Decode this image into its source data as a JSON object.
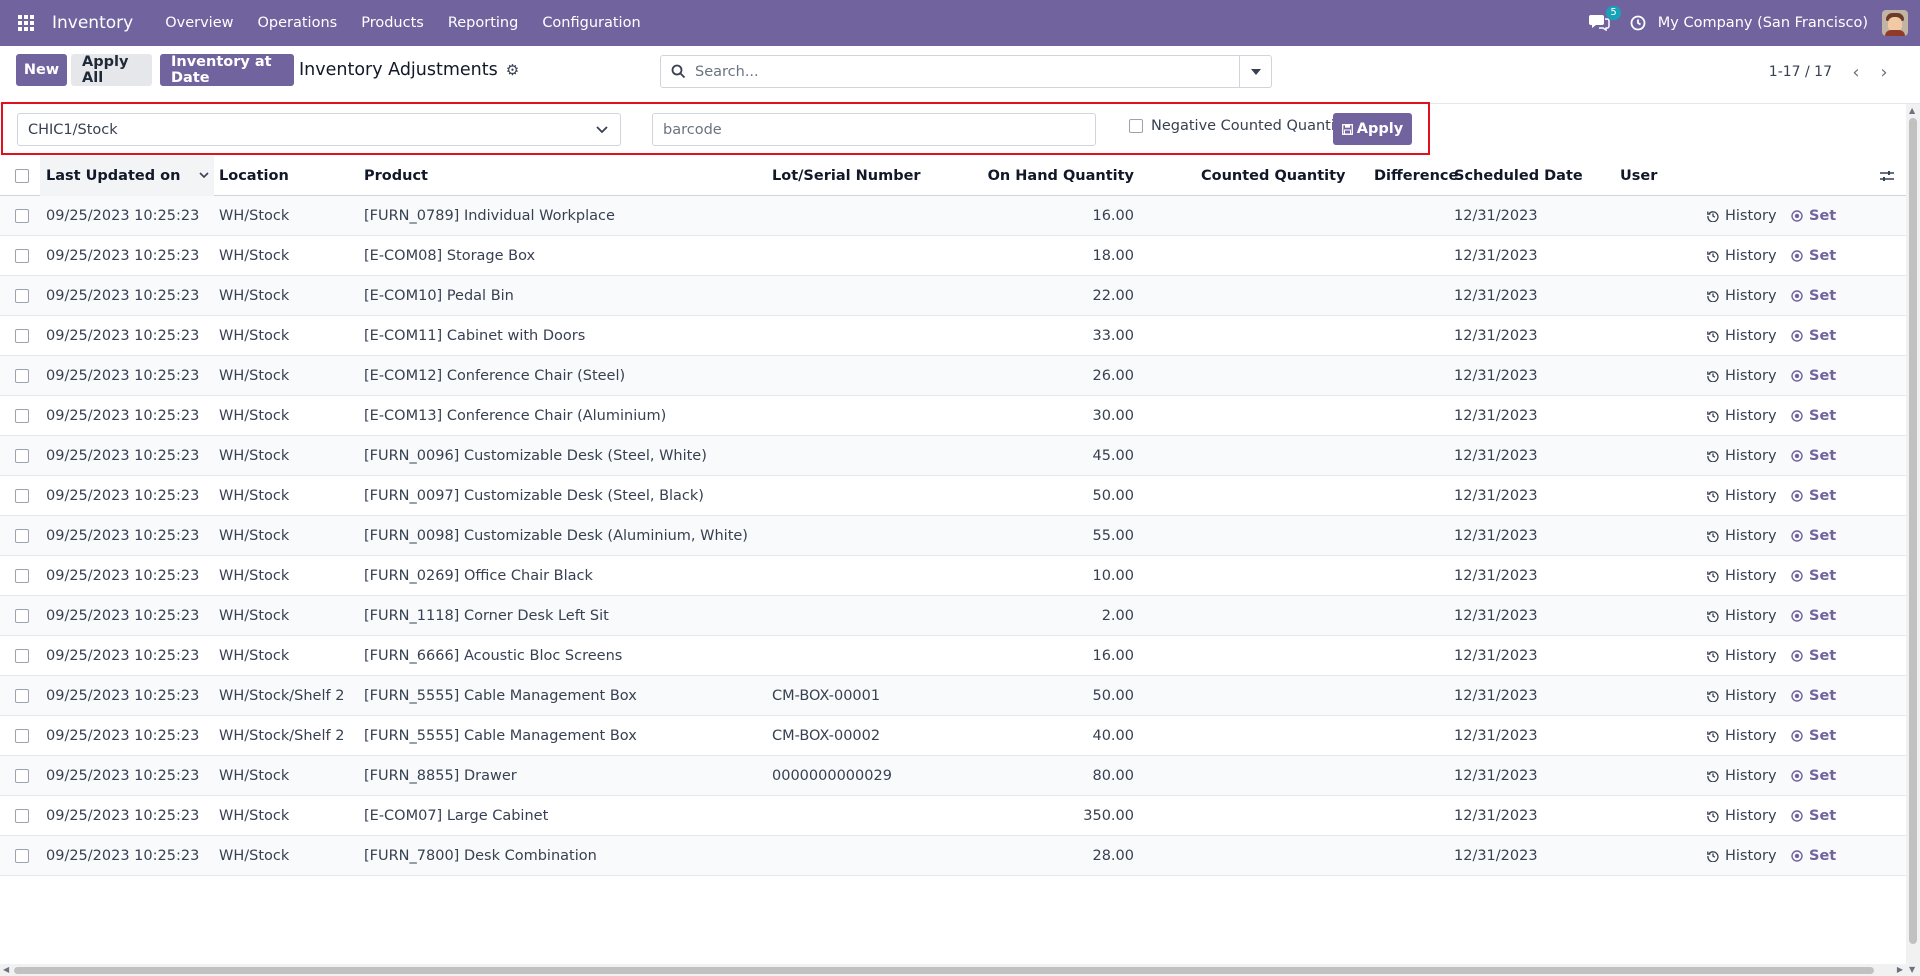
{
  "navbar": {
    "app_name": "Inventory",
    "menu": [
      "Overview",
      "Operations",
      "Products",
      "Reporting",
      "Configuration"
    ],
    "messages_count": "5",
    "company": "My Company (San Francisco)",
    "bg_color": "#71639e"
  },
  "control": {
    "new_label": "New",
    "apply_all_label": "Apply All",
    "inventory_at_date_label": "Inventory at Date",
    "title": "Inventory Adjustments",
    "search_placeholder": "Search...",
    "pager": "1-17 / 17"
  },
  "filter": {
    "location": "CHIC1/Stock",
    "barcode_placeholder": "barcode",
    "negative_label": "Negative Counted Quantity?",
    "apply_label": "Apply"
  },
  "table": {
    "columns": {
      "updated": "Last Updated on",
      "location": "Location",
      "product": "Product",
      "lot": "Lot/Serial Number",
      "on_hand": "On Hand Quantity",
      "counted": "Counted Quantity",
      "difference": "Difference",
      "scheduled": "Scheduled Date",
      "user": "User"
    },
    "history_label": "History",
    "set_label": "Set",
    "rows": [
      {
        "updated": "09/25/2023 10:25:23",
        "location": "WH/Stock",
        "product": "[FURN_0789] Individual Workplace",
        "lot": "",
        "on_hand": "16.00",
        "scheduled": "12/31/2023"
      },
      {
        "updated": "09/25/2023 10:25:23",
        "location": "WH/Stock",
        "product": "[E-COM08] Storage Box",
        "lot": "",
        "on_hand": "18.00",
        "scheduled": "12/31/2023"
      },
      {
        "updated": "09/25/2023 10:25:23",
        "location": "WH/Stock",
        "product": "[E-COM10] Pedal Bin",
        "lot": "",
        "on_hand": "22.00",
        "scheduled": "12/31/2023"
      },
      {
        "updated": "09/25/2023 10:25:23",
        "location": "WH/Stock",
        "product": "[E-COM11] Cabinet with Doors",
        "lot": "",
        "on_hand": "33.00",
        "scheduled": "12/31/2023"
      },
      {
        "updated": "09/25/2023 10:25:23",
        "location": "WH/Stock",
        "product": "[E-COM12] Conference Chair (Steel)",
        "lot": "",
        "on_hand": "26.00",
        "scheduled": "12/31/2023"
      },
      {
        "updated": "09/25/2023 10:25:23",
        "location": "WH/Stock",
        "product": "[E-COM13] Conference Chair (Aluminium)",
        "lot": "",
        "on_hand": "30.00",
        "scheduled": "12/31/2023"
      },
      {
        "updated": "09/25/2023 10:25:23",
        "location": "WH/Stock",
        "product": "[FURN_0096] Customizable Desk (Steel, White)",
        "lot": "",
        "on_hand": "45.00",
        "scheduled": "12/31/2023"
      },
      {
        "updated": "09/25/2023 10:25:23",
        "location": "WH/Stock",
        "product": "[FURN_0097] Customizable Desk (Steel, Black)",
        "lot": "",
        "on_hand": "50.00",
        "scheduled": "12/31/2023"
      },
      {
        "updated": "09/25/2023 10:25:23",
        "location": "WH/Stock",
        "product": "[FURN_0098] Customizable Desk (Aluminium, White)",
        "lot": "",
        "on_hand": "55.00",
        "scheduled": "12/31/2023"
      },
      {
        "updated": "09/25/2023 10:25:23",
        "location": "WH/Stock",
        "product": "[FURN_0269] Office Chair Black",
        "lot": "",
        "on_hand": "10.00",
        "scheduled": "12/31/2023"
      },
      {
        "updated": "09/25/2023 10:25:23",
        "location": "WH/Stock",
        "product": "[FURN_1118] Corner Desk Left Sit",
        "lot": "",
        "on_hand": "2.00",
        "scheduled": "12/31/2023"
      },
      {
        "updated": "09/25/2023 10:25:23",
        "location": "WH/Stock",
        "product": "[FURN_6666] Acoustic Bloc Screens",
        "lot": "",
        "on_hand": "16.00",
        "scheduled": "12/31/2023"
      },
      {
        "updated": "09/25/2023 10:25:23",
        "location": "WH/Stock/Shelf 2",
        "product": "[FURN_5555] Cable Management Box",
        "lot": "CM-BOX-00001",
        "on_hand": "50.00",
        "scheduled": "12/31/2023"
      },
      {
        "updated": "09/25/2023 10:25:23",
        "location": "WH/Stock/Shelf 2",
        "product": "[FURN_5555] Cable Management Box",
        "lot": "CM-BOX-00002",
        "on_hand": "40.00",
        "scheduled": "12/31/2023"
      },
      {
        "updated": "09/25/2023 10:25:23",
        "location": "WH/Stock",
        "product": "[FURN_8855] Drawer",
        "lot": "0000000000029",
        "on_hand": "80.00",
        "scheduled": "12/31/2023"
      },
      {
        "updated": "09/25/2023 10:25:23",
        "location": "WH/Stock",
        "product": "[E-COM07] Large Cabinet",
        "lot": "",
        "on_hand": "350.00",
        "scheduled": "12/31/2023"
      },
      {
        "updated": "09/25/2023 10:25:23",
        "location": "WH/Stock",
        "product": "[FURN_7800] Desk Combination",
        "lot": "",
        "on_hand": "28.00",
        "scheduled": "12/31/2023"
      }
    ]
  }
}
